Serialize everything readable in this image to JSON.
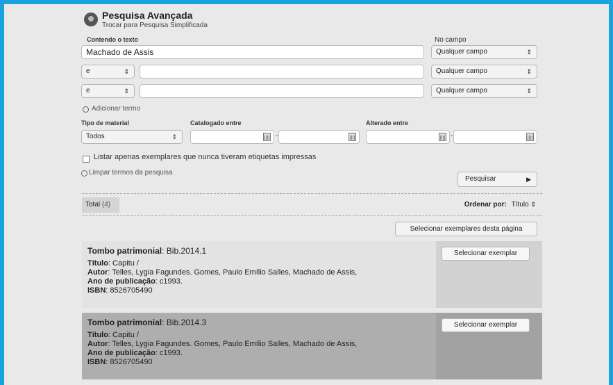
{
  "header": {
    "title": "Pesquisa Avançada",
    "switch_link": "Trocar para Pesquisa Simplificada"
  },
  "search": {
    "contains_label": "Contendo o texto",
    "field_label": "No campo",
    "row1_value": "Machado de Assis",
    "row1_field": "Qualquer campo",
    "row2_operator": "e",
    "row2_value": "",
    "row2_field": "Qualquer campo",
    "row3_operator": "e",
    "row3_value": "",
    "row3_field": "Qualquer campo",
    "add_term": "Adicionar termo"
  },
  "filters": {
    "material_label": "Tipo de material",
    "material_value": "Todos",
    "cataloged_label": "Catalogado entre",
    "altered_label": "Alterado entre",
    "cataloged_from": "",
    "cataloged_to": "",
    "altered_from": "",
    "altered_to": "",
    "date_separator": "-",
    "only_never_printed": "Listar apenas exemplares que nunca tiveram etiquetas impressas"
  },
  "actions": {
    "clear_terms": "Limpar termos da pesquisa",
    "search_button": "Pesquisar"
  },
  "results_bar": {
    "total_label": "Total",
    "total_count": "(4)",
    "sort_label": "Ordenar por:",
    "sort_value": "Título",
    "select_page_button": "Selecionar exemplares desta página"
  },
  "results": [
    {
      "tombo_label": "Tombo patrimonial",
      "tombo_value": ": Bib.2014.1",
      "titulo_label": "Título",
      "titulo_value": ": Capitu /",
      "autor_label": "Autor",
      "autor_value": ": Telles, Lygia Fagundes. Gomes, Paulo Emílio Salles, Machado de Assis,",
      "ano_label": "Ano de publicação",
      "ano_value": ": c1993.",
      "isbn_label": "ISBN",
      "isbn_value": ": 8526705490",
      "select_button": "Selecionar exemplar"
    },
    {
      "tombo_label": "Tombo patrimonial",
      "tombo_value": ": Bib.2014.3",
      "titulo_label": "Título",
      "titulo_value": ": Capitu /",
      "autor_label": "Autor",
      "autor_value": ": Telles, Lygia Fagundes. Gomes, Paulo Emílio Salles, Machado de Assis,",
      "ano_label": "Ano de publicação",
      "ano_value": ": c1993.",
      "isbn_label": "ISBN",
      "isbn_value": ": 8526705490",
      "select_button": "Selecionar exemplar"
    }
  ],
  "icons": {
    "title_icon": "map-pin-icon",
    "select_arrows": "updown-arrows-icon",
    "calendar": "calendar-icon",
    "add": "plus-circle-icon",
    "clear": "minus-circle-icon",
    "play": "triangle-right-icon"
  },
  "colors": {
    "frame": "#1aa3dc",
    "background": "#e9e9e9",
    "result_1_bg": "#e3e3e3",
    "result_1_side": "#d2d2d2",
    "result_2_bg": "#aeaeae",
    "result_2_side": "#a2a2a2"
  }
}
